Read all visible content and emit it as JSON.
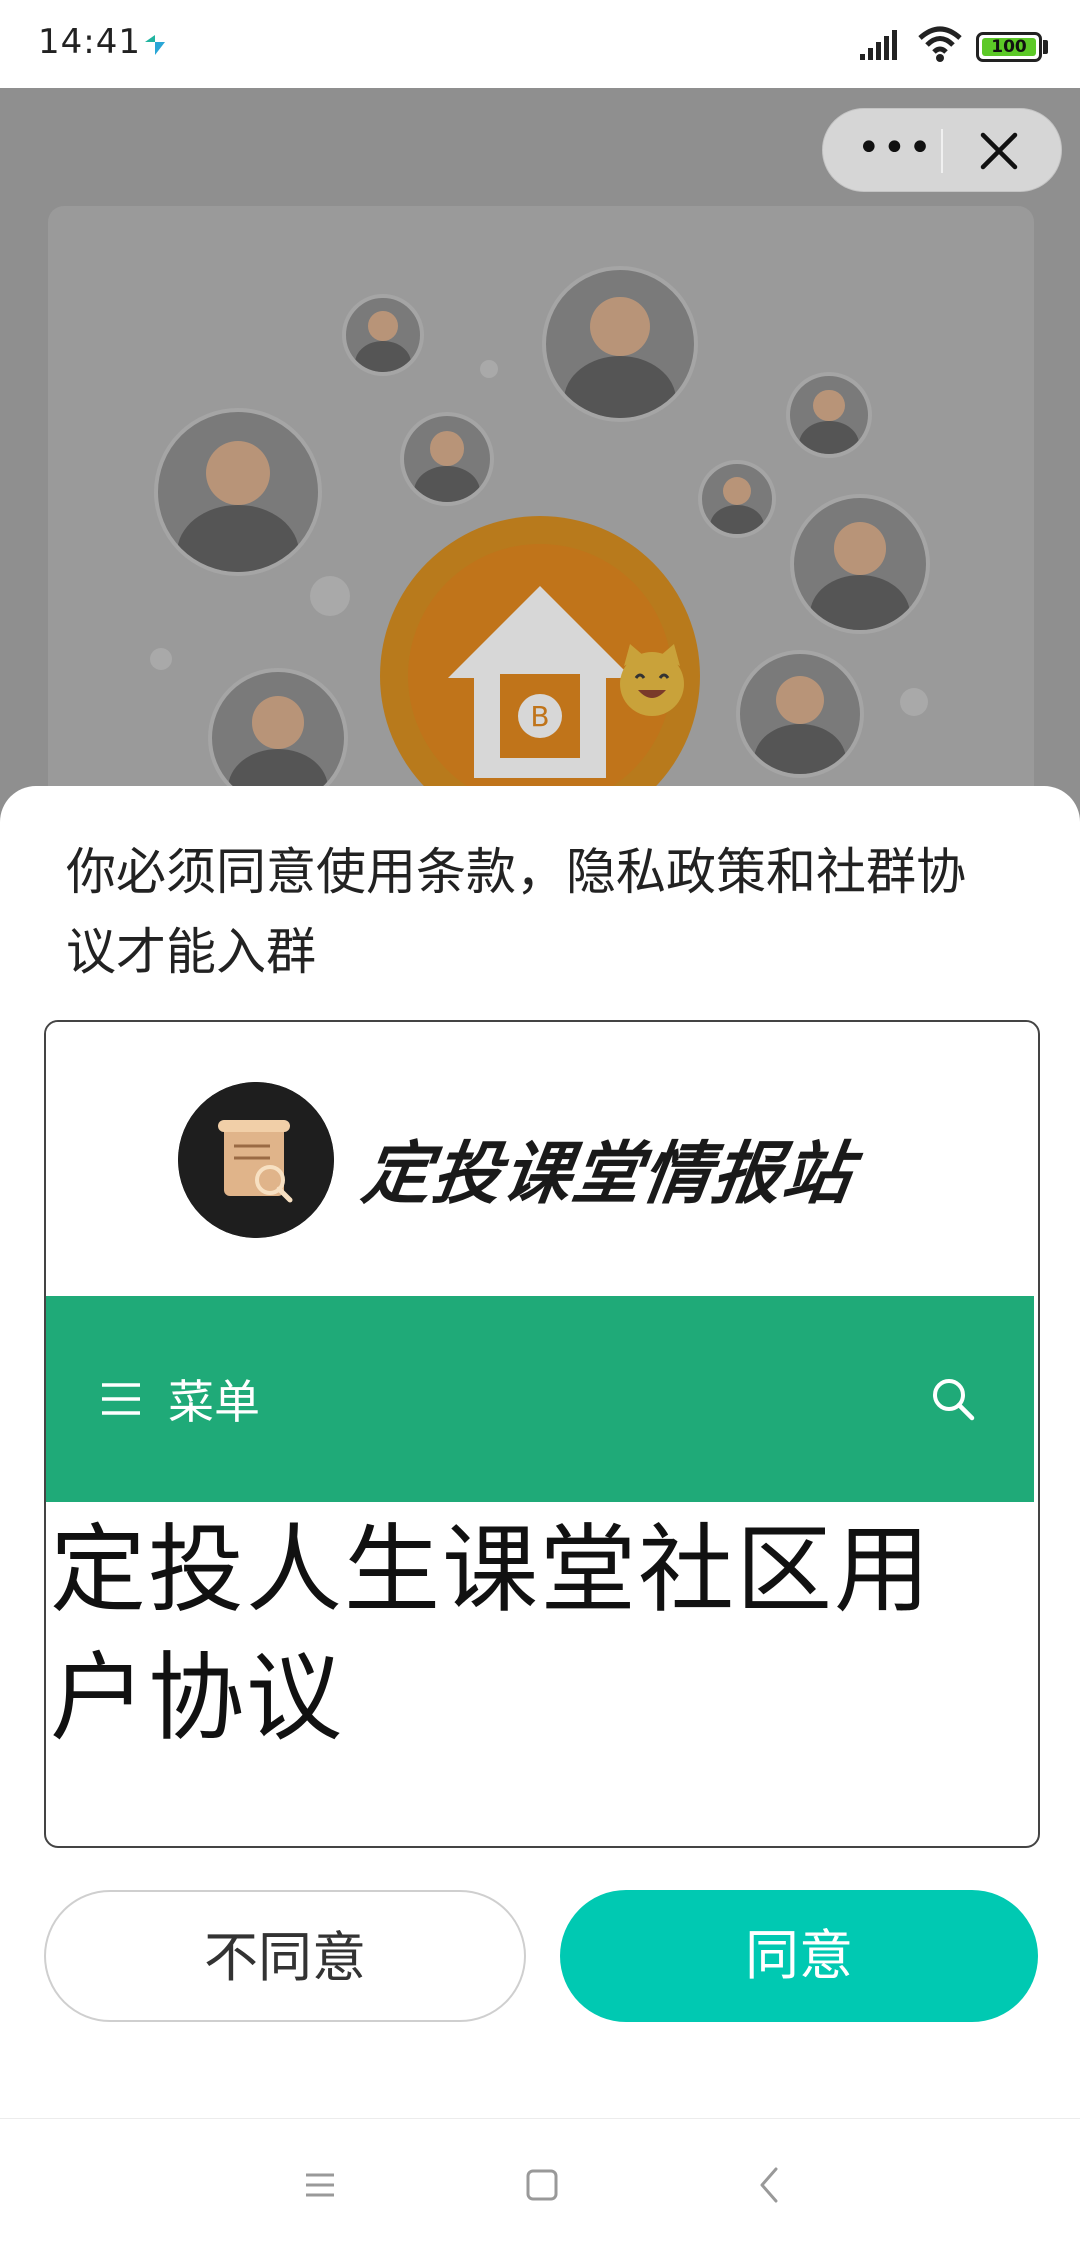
{
  "status_bar": {
    "time": "14:41",
    "battery": "100",
    "app_icon": "app-notification-icon",
    "signal_icon": "signal-icon",
    "wifi_icon": "wifi-icon"
  },
  "capsule": {
    "more_label": "•••",
    "more_icon": "more-icon",
    "close_icon": "close-icon"
  },
  "dialog": {
    "title": "你必须同意使用条款，隐私政策和社群协议才能入群",
    "site": {
      "name": "定投课堂情报站",
      "logo_icon": "scroll-magnifier-logo",
      "menu_label": "菜单",
      "menu_icon": "hamburger-icon",
      "search_icon": "search-icon",
      "accent_color": "#1faa78"
    },
    "heading": "定投人生课堂社区用户协议",
    "disagree_label": "不同意",
    "agree_label": "同意",
    "agree_color": "#00c9b2"
  },
  "nav_bar": {
    "menu_icon": "recents-icon",
    "home_icon": "home-icon",
    "back_icon": "back-icon"
  }
}
